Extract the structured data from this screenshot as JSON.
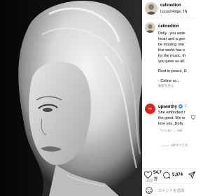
{
  "post": {
    "author": "celinedion",
    "location": "Locust Ridge, TN",
    "caption_lines": [
      "Dolly...you were",
      "heart and a gen",
      "be missing one",
      "this world has e",
      "for the music, th",
      "you gave us all."
    ],
    "caption_rest": "Rest in peace, D",
    "caption_sign": "- Celine xx...",
    "translate_link": "翻訳を見る"
  },
  "comment": {
    "author": "upworthy",
    "time": "2",
    "lines": [
      "She embodied t",
      "the good. We w",
      "love you, Dolly."
    ],
    "likes_link": "「いいね！」598",
    "replies_link": "4件すべての"
  },
  "actions": {
    "likes_count": "54.7",
    "likes_unit": "万",
    "comments_count": "5,074",
    "date": "2日前"
  },
  "add_comment": {
    "placeholder": "コメントを追加"
  },
  "photo": {
    "icons": [
      "heart-icon",
      "comment-icon",
      "share-icon",
      "smile-icon"
    ]
  }
}
